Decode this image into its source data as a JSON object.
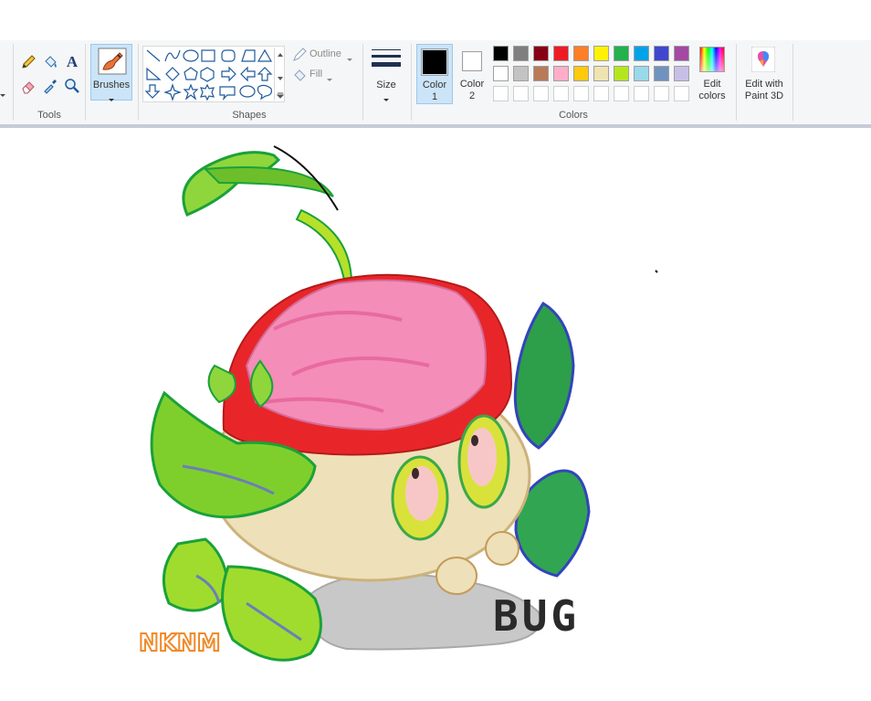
{
  "groups": {
    "tools_label": "Tools",
    "shapes_label": "Shapes",
    "colors_label": "Colors"
  },
  "brushes_label": "Brushes",
  "outline_label": "Outline",
  "fill_label": "Fill",
  "size_label": "Size",
  "color1": {
    "label1": "Color",
    "label2": "1",
    "value": "#000000"
  },
  "color2": {
    "label1": "Color",
    "label2": "2",
    "value": "#ffffff"
  },
  "edit_colors": {
    "line1": "Edit",
    "line2": "colors"
  },
  "paint3d": {
    "line1": "Edit with",
    "line2": "Paint 3D"
  },
  "palette_row1": [
    "#000000",
    "#7f7f7f",
    "#880015",
    "#ed1c24",
    "#ff7f27",
    "#fff200",
    "#22b14c",
    "#00a2e8",
    "#3f48cc",
    "#a349a4"
  ],
  "palette_row2": [
    "#ffffff",
    "#c3c3c3",
    "#b97a57",
    "#ffaec9",
    "#ffc90e",
    "#efe4b0",
    "#b5e61d",
    "#99d9ea",
    "#7092be",
    "#c8bfe7"
  ],
  "palette_row3": [
    "#ffffff",
    "#ffffff",
    "#ffffff",
    "#ffffff",
    "#ffffff",
    "#ffffff",
    "#ffffff",
    "#ffffff",
    "#ffffff",
    "#ffffff"
  ],
  "drawing": {
    "title_letters": "BUG",
    "signature": "NKNM"
  }
}
